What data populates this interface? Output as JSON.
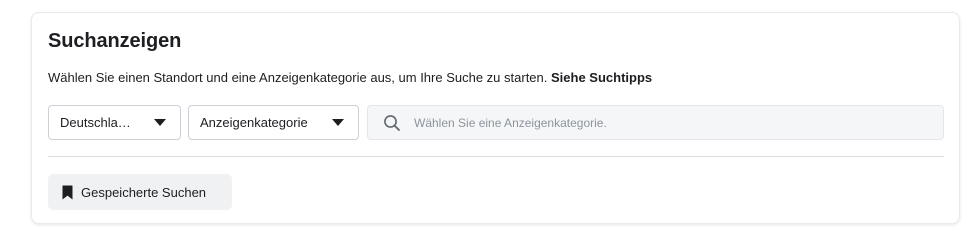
{
  "header": {
    "title": "Suchanzeigen"
  },
  "description": {
    "text": "Wählen Sie einen Standort und eine Anzeigenkategorie aus, um Ihre Suche zu starten.",
    "link": "Siehe Suchtipps"
  },
  "filters": {
    "country": "Deutschla…",
    "category": "Anzeigenkategorie"
  },
  "search": {
    "placeholder": "Wählen Sie eine Anzeigenkategorie.",
    "icon": "search-icon"
  },
  "saved": {
    "label": "Gespeicherte Suchen",
    "icon": "bookmark-icon"
  }
}
